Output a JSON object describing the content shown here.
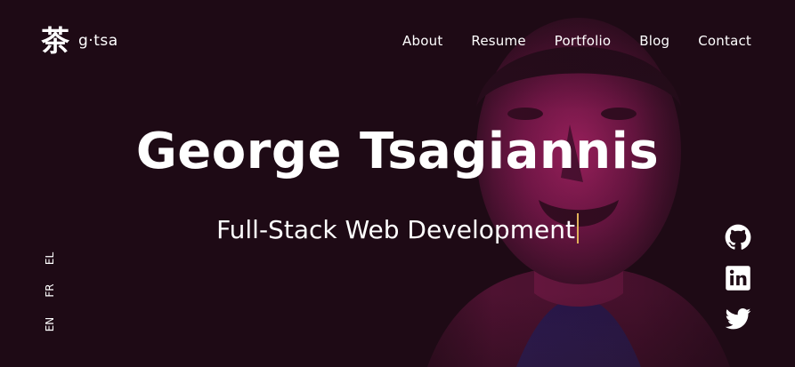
{
  "brand": {
    "mark": "茶",
    "name": "g·tsa"
  },
  "nav": {
    "items": [
      "About",
      "Resume",
      "Portfolio",
      "Blog",
      "Contact"
    ]
  },
  "hero": {
    "title": "George Tsagiannis",
    "subtitle": "Full-Stack Web Development"
  },
  "languages": [
    "EL",
    "FR",
    "EN"
  ],
  "socials": [
    {
      "icon": "github-icon"
    },
    {
      "icon": "linkedin-icon"
    },
    {
      "icon": "twitter-icon"
    }
  ],
  "colors": {
    "background": "#1e0a15",
    "accent_magenta": "#b0206a",
    "caret": "#e0b15a",
    "text": "#ffffff"
  }
}
